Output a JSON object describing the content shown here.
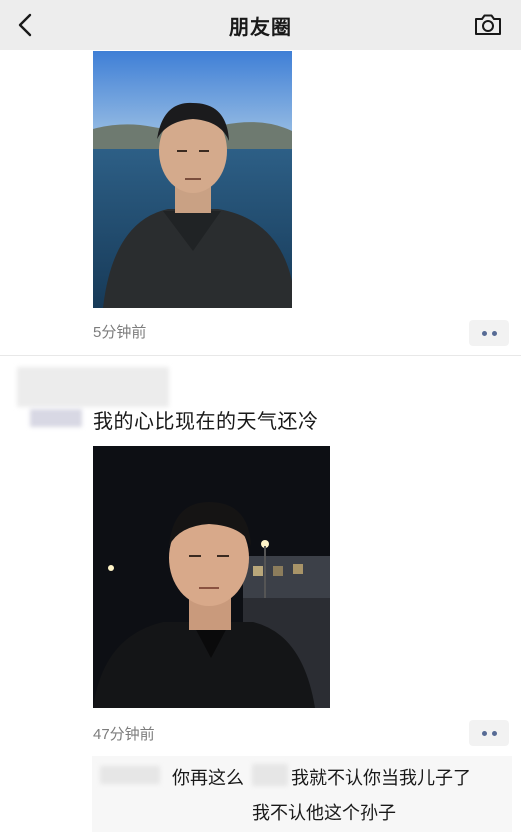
{
  "nav": {
    "title": "朋友圈",
    "back_icon": "chevron-left-icon",
    "camera_icon": "camera-icon"
  },
  "post1": {
    "time": "5分钟前",
    "photo": "selfie-by-lake"
  },
  "post2": {
    "caption": "我的心比现在的天气还冷",
    "time": "47分钟前",
    "photo": "night-street-selfie"
  },
  "comments": [
    {
      "before": "你再这么",
      "after": "我就不认你当我儿子了"
    },
    {
      "text": "我不认他这个孙子"
    }
  ],
  "colors": {
    "nav_bg": "#ededed",
    "link_blue": "#576b95",
    "timestamp_gray": "#7d7d7d"
  }
}
